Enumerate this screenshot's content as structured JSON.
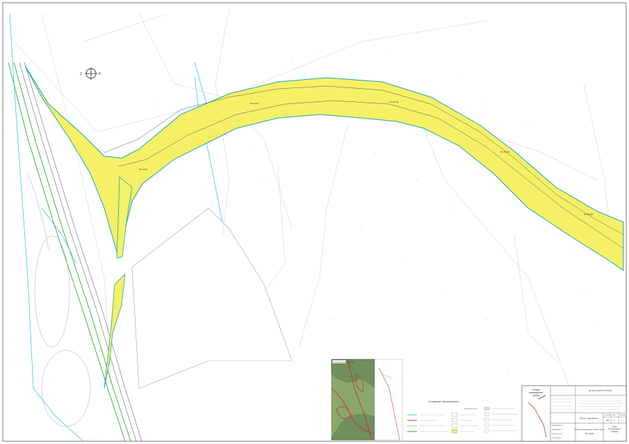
{
  "map": {
    "compass": {
      "north_label": "2",
      "east_label": "8"
    },
    "road_labels": [
      "ПК 2+00",
      "ПК 5+00",
      "ПК 10+00",
      "ПК 15+00",
      "ПК 20+00"
    ],
    "colors": {
      "allotment_fill": "#f6f066",
      "allotment_outline": "#1aa3b8",
      "rail_green": "#36a836",
      "water_cyan": "#38c8dd",
      "pipeline_red": "#d33a3a"
    }
  },
  "inset": {
    "title": "Схема расположения"
  },
  "legend": {
    "title": "Условные обозначения",
    "header": "Обозначения"
  },
  "stamp": {
    "scheme_title": "Схема\nразмещения\nтрассы",
    "document_title": "Договор 001/10-ТП/2017",
    "role_rows": [
      "Разработал",
      "Проверил",
      "Н.контроль",
      "Утвердил"
    ],
    "project_title": "Проект межевания",
    "stage": "Стадия",
    "sheet": "Лист",
    "sheets": "Листов",
    "sheet_values": [
      "ПМ",
      "1",
      "1"
    ],
    "plan_title": "Проект межевания территории",
    "scale": "М 1:2000",
    "org": "ООО\n\"ГЕОПРОЕКТ\"\nг.Казань"
  }
}
